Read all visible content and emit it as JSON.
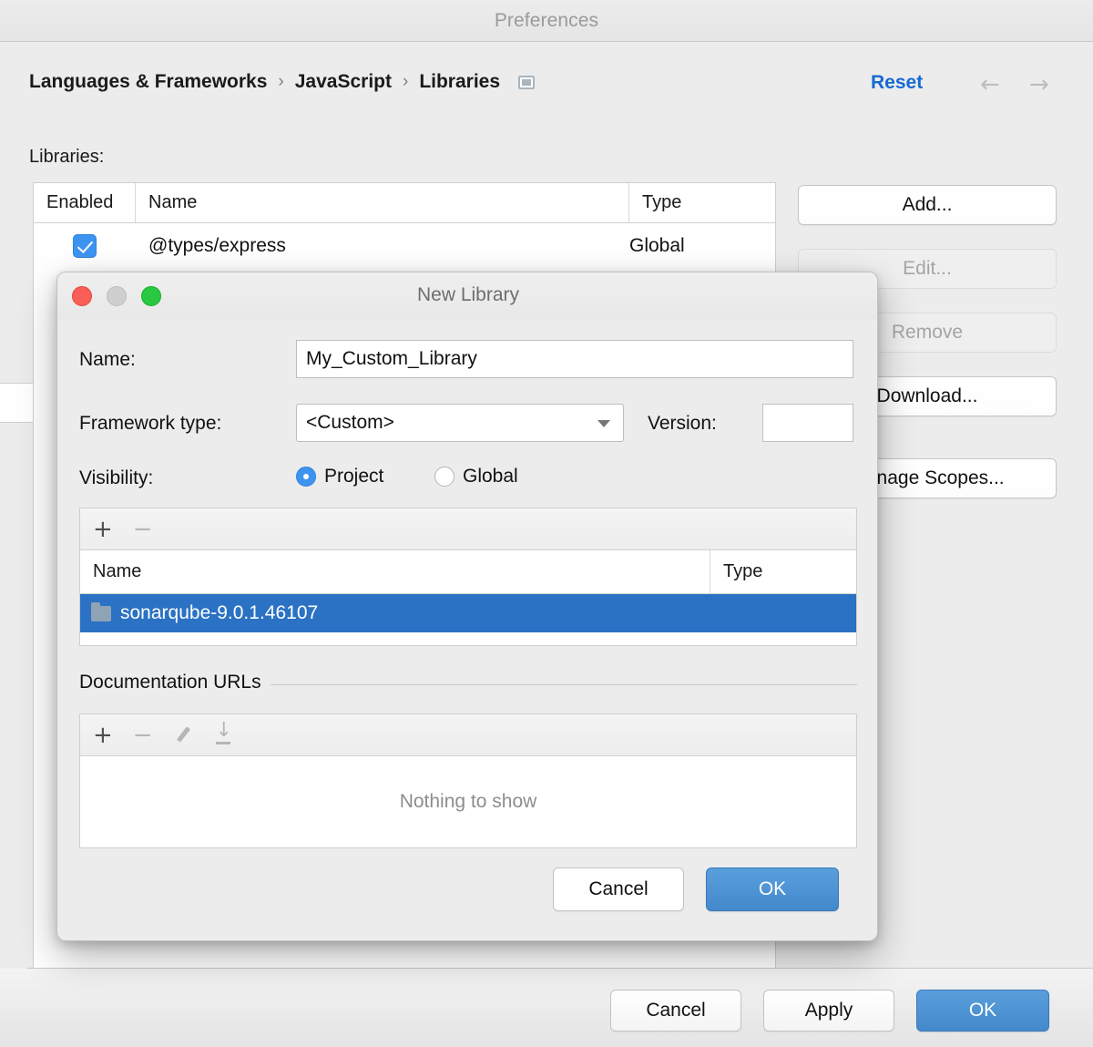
{
  "window": {
    "title": "Preferences",
    "breadcrumb": [
      "Languages & Frameworks",
      "JavaScript",
      "Libraries"
    ],
    "breadcrumb_separator": "›",
    "reset_label": "Reset",
    "nav_back_glyph": "←",
    "nav_forward_glyph": "→",
    "panel_icon_name": "panel-icon"
  },
  "libraries_section": {
    "label": "Libraries:",
    "columns": [
      "Enabled",
      "Name",
      "Type"
    ],
    "rows": [
      {
        "enabled": true,
        "name": "@types/express",
        "type": "Global"
      }
    ],
    "buttons": [
      {
        "label": "Add...",
        "enabled": true
      },
      {
        "label": "Edit...",
        "enabled": false
      },
      {
        "label": "Remove",
        "enabled": false
      },
      {
        "label": "Download...",
        "enabled": true
      },
      {
        "label": "Manage Scopes...",
        "enabled": true
      }
    ]
  },
  "footer": {
    "cancel_label": "Cancel",
    "apply_label": "Apply",
    "ok_label": "OK"
  },
  "dialog": {
    "title": "New Library",
    "traffic_lights": {
      "close": "close-button",
      "minimize": "minimize-button",
      "maximize": "maximize-button"
    },
    "name_label": "Name:",
    "name_value": "My_Custom_Library",
    "framework_label": "Framework type:",
    "framework_value": "<Custom>",
    "version_label": "Version:",
    "version_value": "",
    "visibility_label": "Visibility:",
    "visibility_options": [
      {
        "label": "Project",
        "selected": true
      },
      {
        "label": "Global",
        "selected": false
      }
    ],
    "paths": {
      "toolbar": [
        {
          "glyph": "+",
          "name": "add-path-button",
          "enabled": true
        },
        {
          "glyph": "−",
          "name": "remove-path-button",
          "enabled": false
        }
      ],
      "columns": [
        "Name",
        "Type"
      ],
      "rows": [
        {
          "name": "sonarqube-9.0.1.46107",
          "type": "",
          "selected": true,
          "icon": "folder-icon"
        }
      ]
    },
    "doc_urls": {
      "group_title": "Documentation URLs",
      "toolbar": [
        {
          "glyph": "+",
          "name": "add-url-button",
          "enabled": true
        },
        {
          "glyph": "−",
          "name": "remove-url-button",
          "enabled": false
        },
        {
          "glyph": "",
          "name": "edit-url-button",
          "enabled": false
        },
        {
          "glyph": "",
          "name": "download-url-button",
          "enabled": false
        }
      ],
      "empty_text": "Nothing to show"
    },
    "cancel_label": "Cancel",
    "ok_label": "OK"
  },
  "colors": {
    "accent_blue": "#3d94f0",
    "selection_blue": "#2b72c4",
    "primary_button": "#4389cb",
    "link_blue": "#1669d4",
    "window_bg": "#ececec",
    "close_red": "#fa5f57",
    "minimize_gray": "#cfcfcf",
    "maximize_green": "#28c840"
  }
}
